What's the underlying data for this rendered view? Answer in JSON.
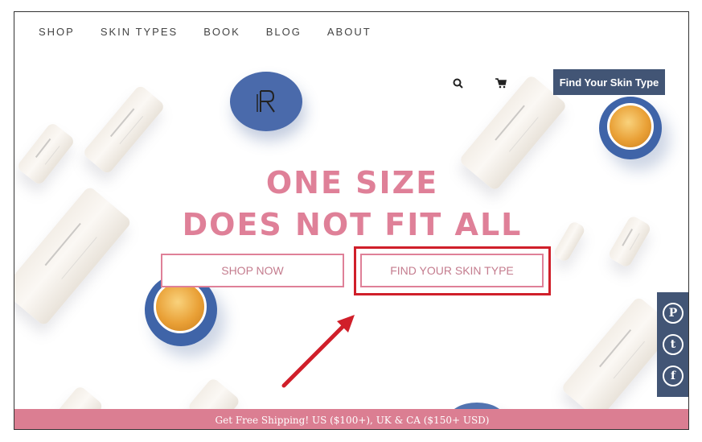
{
  "nav": {
    "items": [
      {
        "label": "SHOP"
      },
      {
        "label": "SKIN TYPES"
      },
      {
        "label": "BOOK"
      },
      {
        "label": "BLOG"
      },
      {
        "label": "ABOUT"
      }
    ]
  },
  "header": {
    "cta_label": "Find Your Skin Type"
  },
  "hero": {
    "headline_line1": "ONE SIZE",
    "headline_line2": "DOES NOT FIT ALL",
    "shop_now_label": "SHOP NOW",
    "find_skin_type_label": "FIND YOUR SKIN TYPE"
  },
  "social": {
    "pinterest": "P",
    "twitter": "t",
    "facebook": "f"
  },
  "banner": {
    "text": "Get Free Shipping! US ($100+), UK & CA ($150+ USD)"
  },
  "colors": {
    "accent_pink": "#df8098",
    "navy": "#425575",
    "highlight_red": "#d01f2a"
  }
}
